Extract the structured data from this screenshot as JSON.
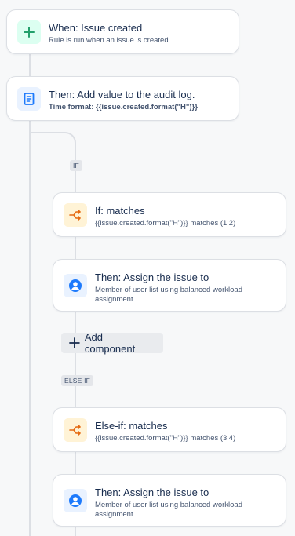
{
  "trigger": {
    "title": "When: Issue created",
    "subtitle": "Rule is run when an issue is created.",
    "icon": "plus-icon",
    "color": "#22a06b"
  },
  "audit": {
    "title": "Then: Add value to the audit log.",
    "subtitle": "Time format: {{issue.created.format(\"H\")}}",
    "icon": "document-icon",
    "color": "#1d7afc"
  },
  "if_tag": "IF",
  "if_card": {
    "title": "If: matches",
    "subtitle": "{{issue.created.format(\"H\")}} matches (1|2)",
    "icon": "branch-icon",
    "color": "#e56910"
  },
  "assign1": {
    "title": "Then: Assign the issue to",
    "subtitle": "Member of user list using balanced workload assignment",
    "icon": "user-icon",
    "color": "#1d7afc"
  },
  "add_component": {
    "label": "Add component"
  },
  "else_if_tag": "ELSE IF",
  "else_if_card": {
    "title": "Else-if: matches",
    "subtitle": "{{issue.created.format(\"H\")}} matches (3|4)",
    "icon": "branch-icon",
    "color": "#e56910"
  },
  "assign2": {
    "title": "Then: Assign the issue to",
    "subtitle": "Member of user list using balanced workload assignment",
    "icon": "user-icon",
    "color": "#1d7afc"
  }
}
